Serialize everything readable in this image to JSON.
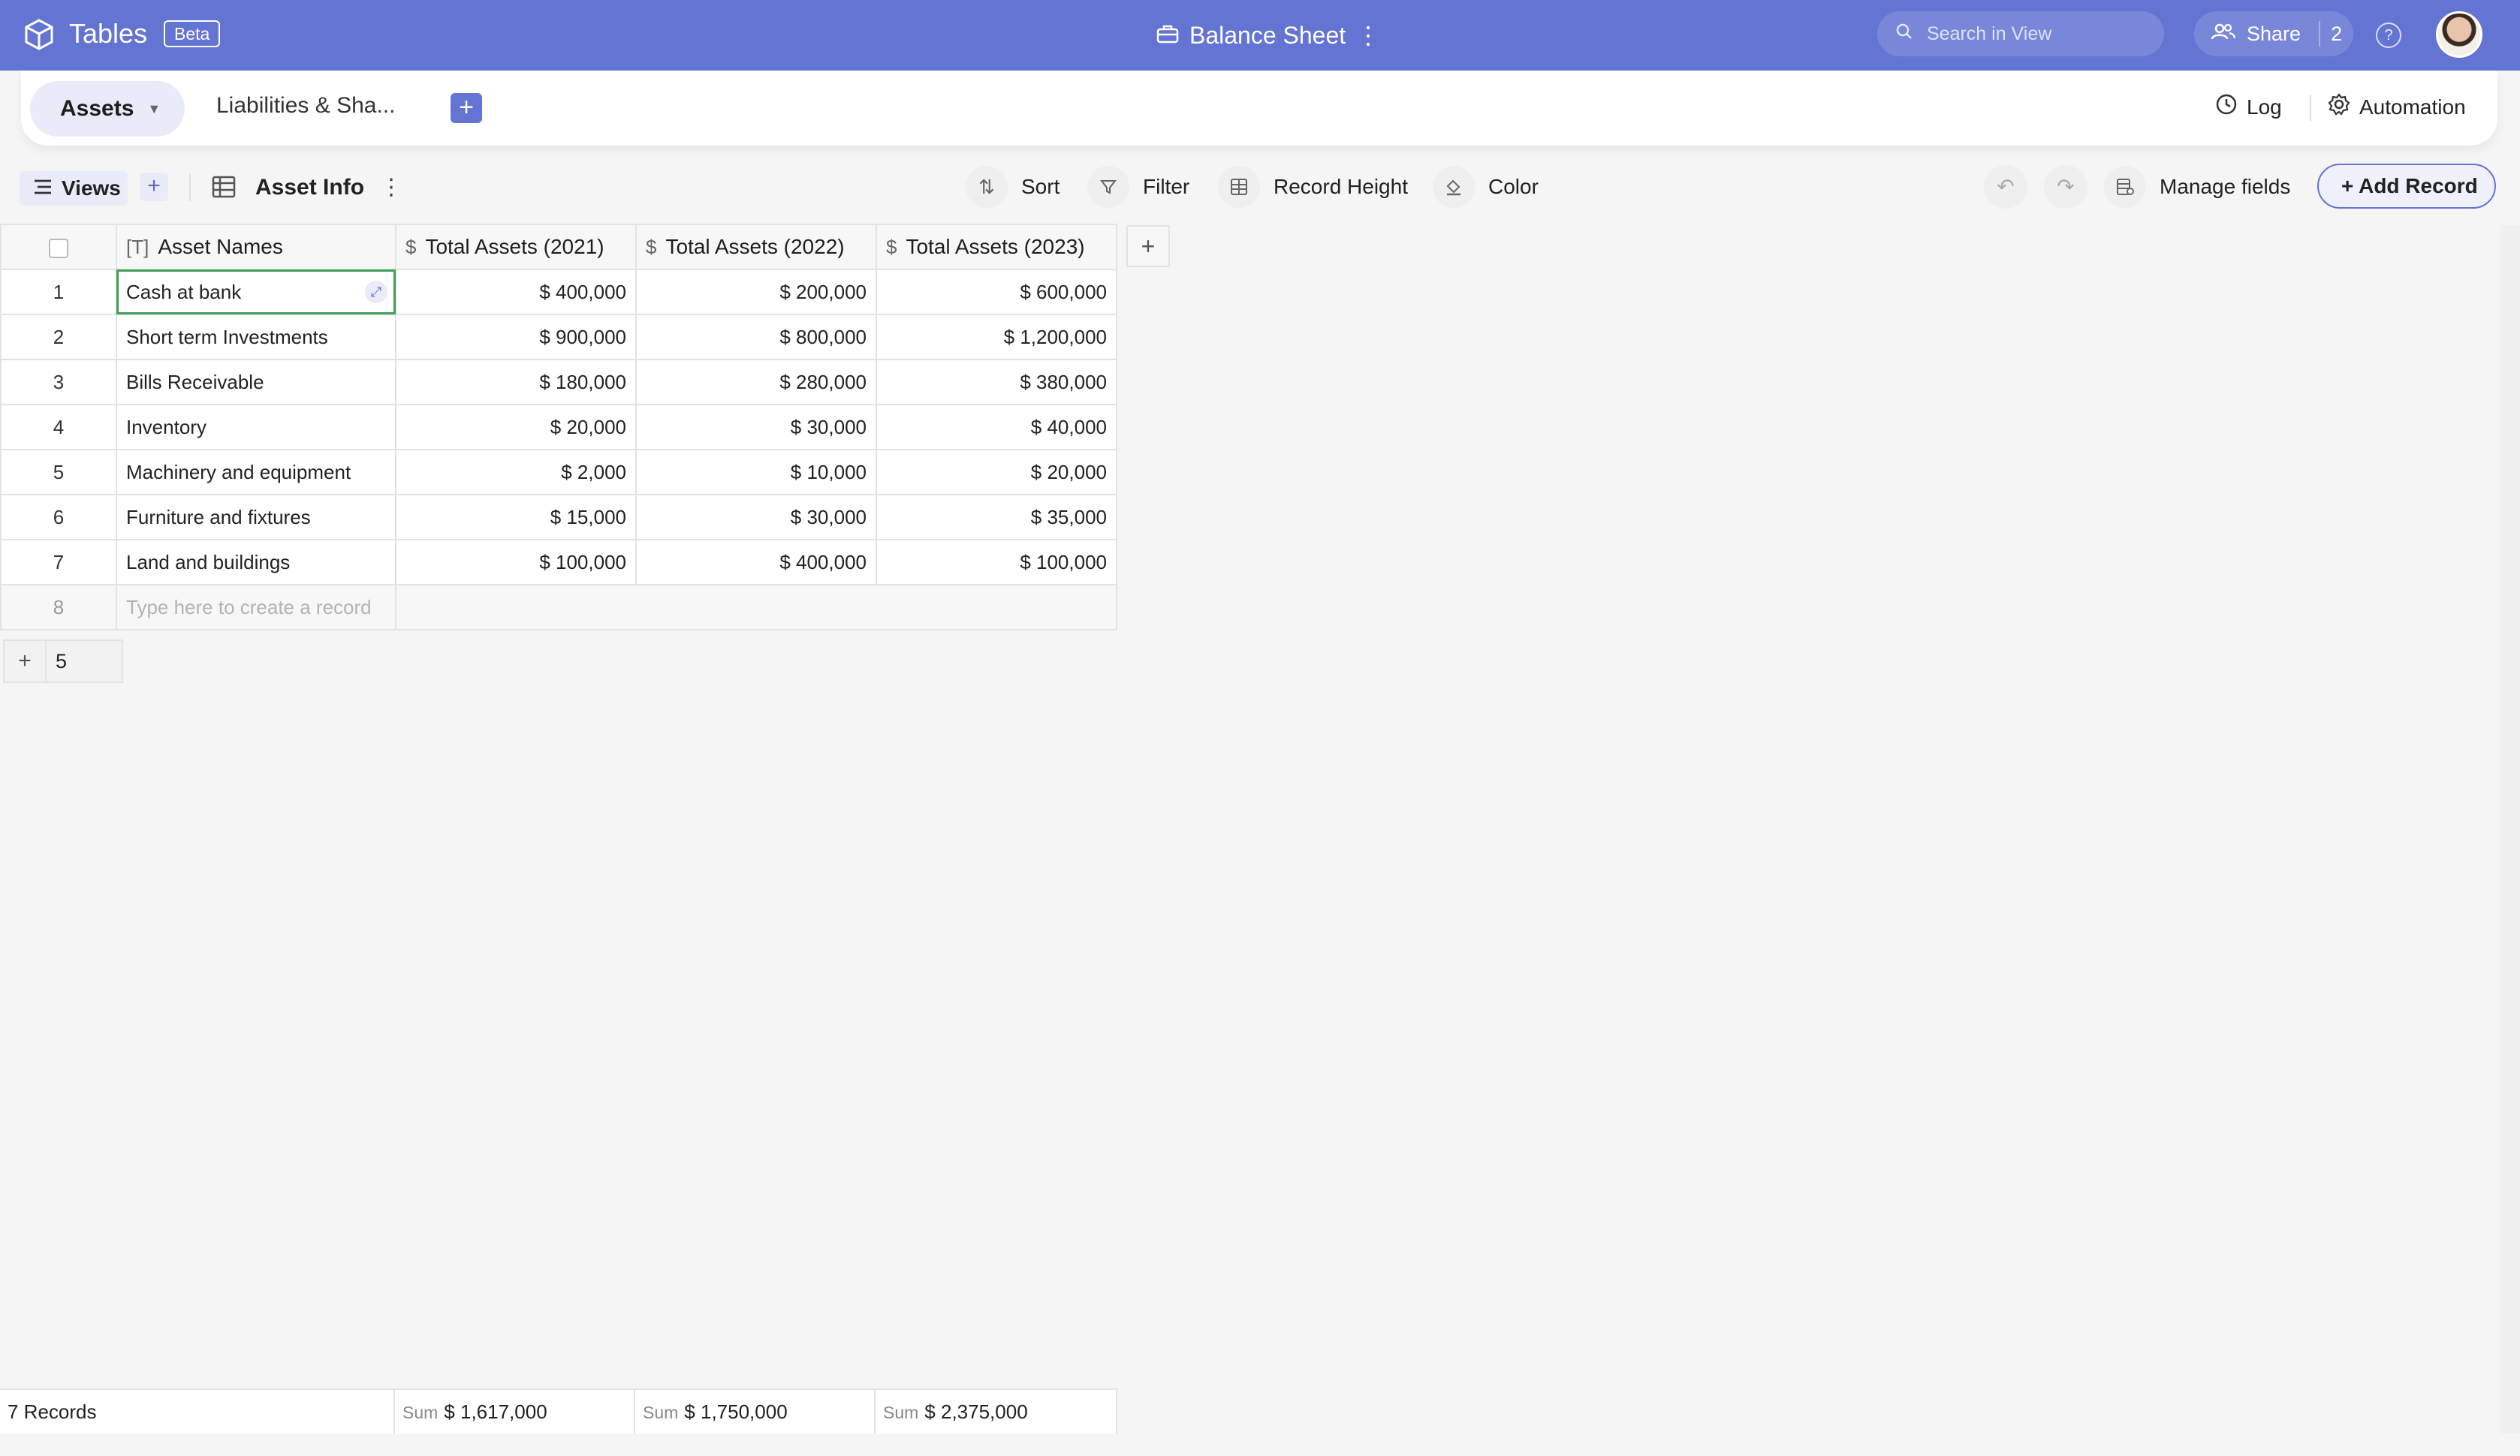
{
  "app": {
    "title": "Tables",
    "badge": "Beta",
    "doc_title": "Balance Sheet"
  },
  "search": {
    "placeholder": "Search in View"
  },
  "share": {
    "label": "Share",
    "count": "2"
  },
  "tabs": [
    {
      "label": "Assets"
    },
    {
      "label": "Liabilities & Sha..."
    }
  ],
  "topright": {
    "log": "Log",
    "automation": "Automation"
  },
  "toolbar": {
    "views": "Views",
    "view_name": "Asset Info",
    "sort": "Sort",
    "filter": "Filter",
    "record_height": "Record Height",
    "color": "Color",
    "manage_fields": "Manage fields",
    "add_record": "+ Add Record"
  },
  "table": {
    "columns": [
      "Asset Names",
      "Total Assets (2021)",
      "Total Assets (2022)",
      "Total Assets (2023)"
    ],
    "currency_symbol": "$",
    "rows": [
      {
        "n": "1",
        "name": "Cash at bank",
        "y2021": "$ 400,000",
        "y2022": "$ 200,000",
        "y2023": "$ 600,000"
      },
      {
        "n": "2",
        "name": "Short term Investments",
        "y2021": "$ 900,000",
        "y2022": "$ 800,000",
        "y2023": "$ 1,200,000"
      },
      {
        "n": "3",
        "name": "Bills Receivable",
        "y2021": "$ 180,000",
        "y2022": "$ 280,000",
        "y2023": "$ 380,000"
      },
      {
        "n": "4",
        "name": "Inventory",
        "y2021": "$ 20,000",
        "y2022": "$ 30,000",
        "y2023": "$ 40,000"
      },
      {
        "n": "5",
        "name": "Machinery and equipment",
        "y2021": "$ 2,000",
        "y2022": "$ 10,000",
        "y2023": "$ 20,000"
      },
      {
        "n": "6",
        "name": "Furniture and fixtures",
        "y2021": "$ 15,000",
        "y2022": "$ 30,000",
        "y2023": "$ 35,000"
      },
      {
        "n": "7",
        "name": "Land and buildings",
        "y2021": "$ 100,000",
        "y2022": "$ 400,000",
        "y2023": "$ 100,000"
      }
    ],
    "new_row_num": "8",
    "new_row_placeholder": "Type here to create a record",
    "add_count": "5"
  },
  "footer": {
    "records": "7 Records",
    "sum_label": "Sum",
    "sum2021": "$ 1,617,000",
    "sum2022": "$ 1,750,000",
    "sum2023": "$ 2,375,000"
  },
  "colors": {
    "brand": "#6474d2",
    "selection": "#3f9e5a"
  }
}
